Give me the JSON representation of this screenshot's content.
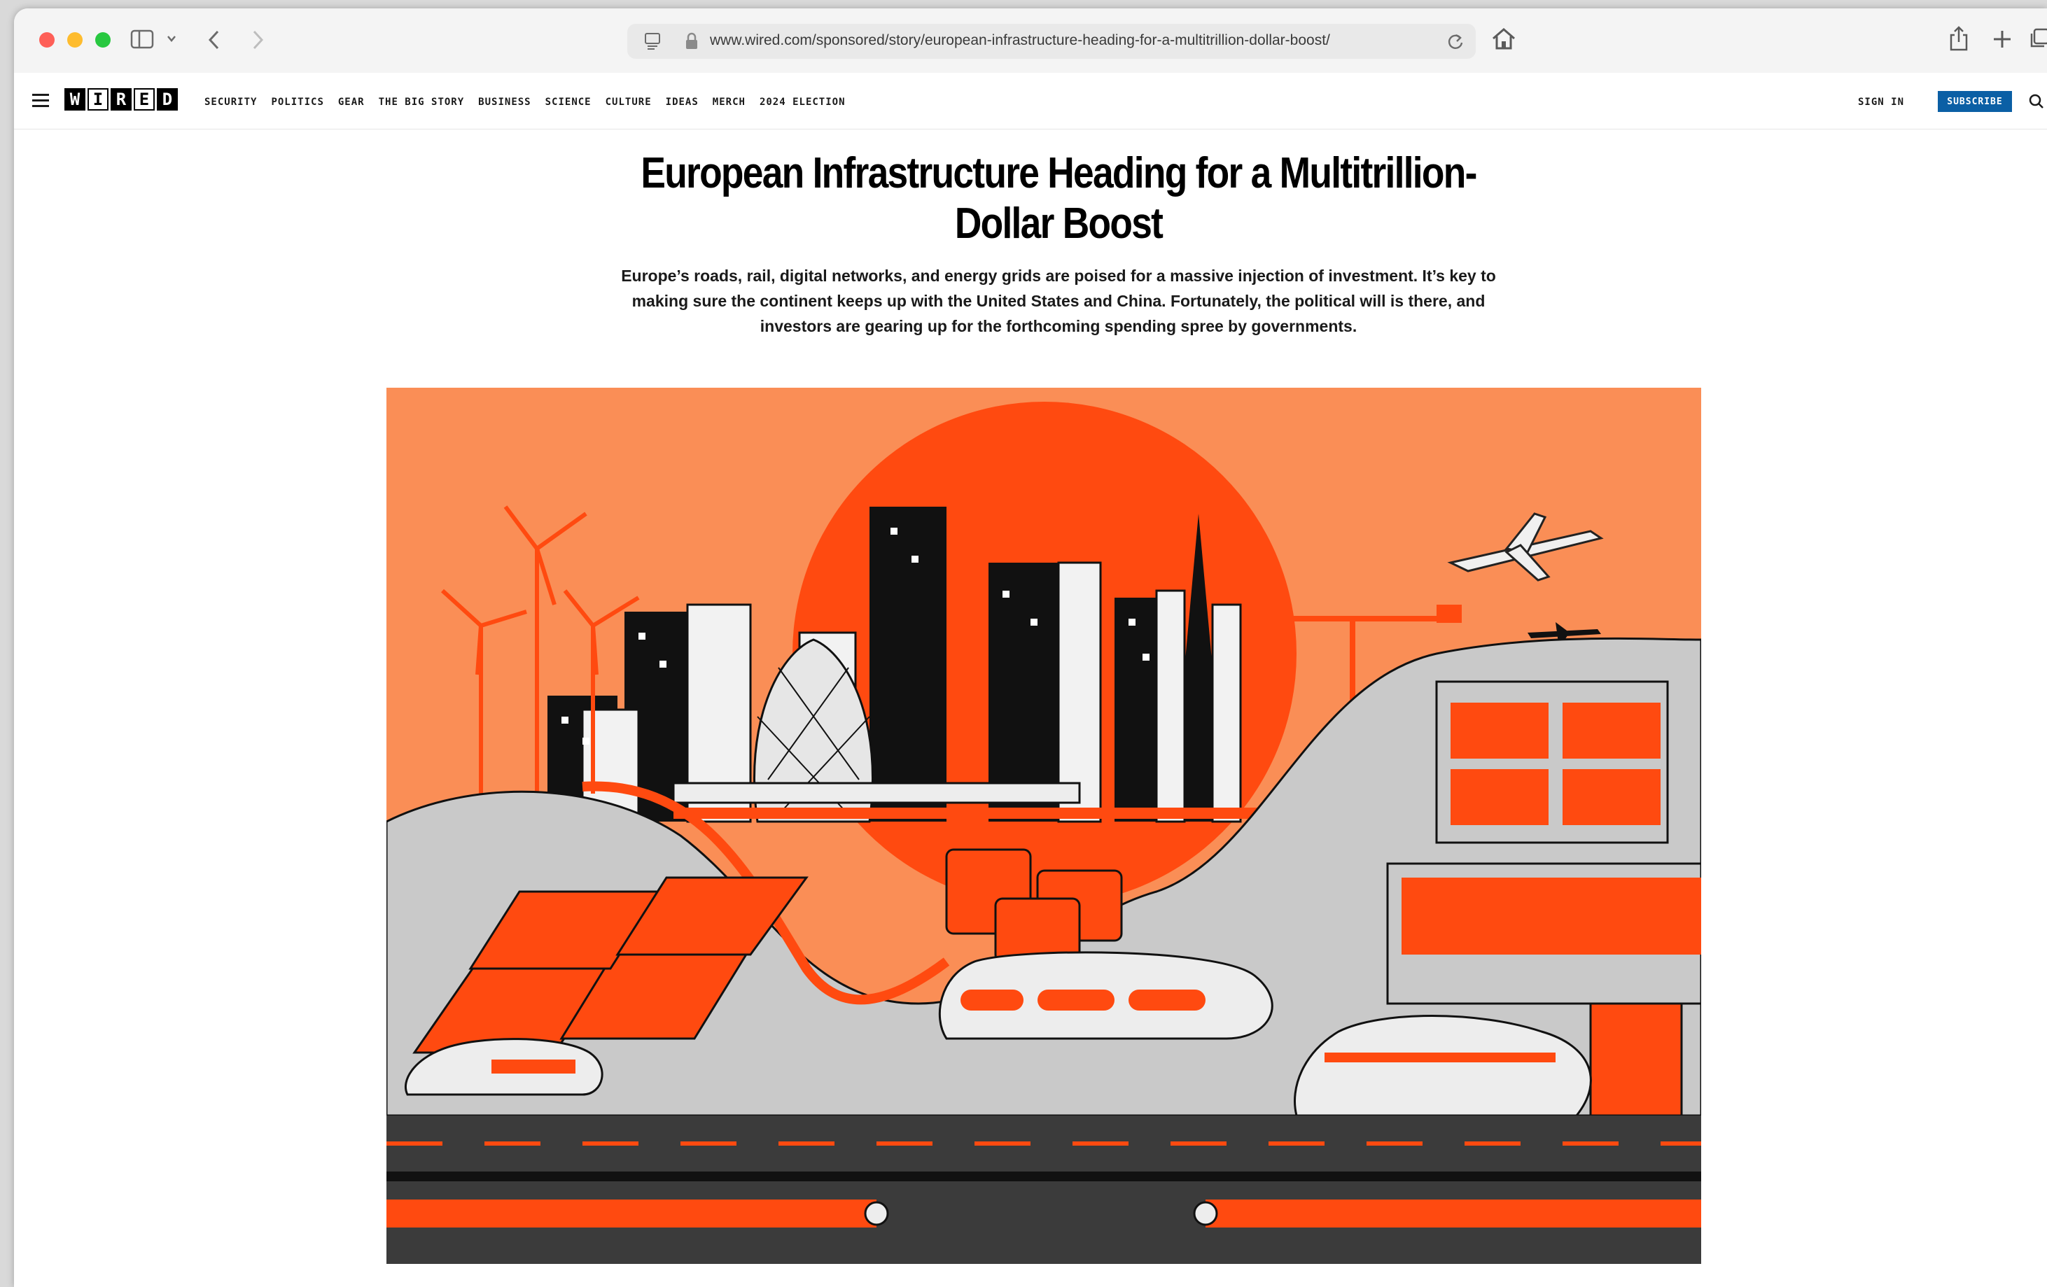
{
  "browser": {
    "url": "www.wired.com/sponsored/story/european-infrastructure-heading-for-a-multitrillion-dollar-boost/"
  },
  "site": {
    "logo_letters": [
      "W",
      "I",
      "R",
      "E",
      "D"
    ],
    "nav": [
      "SECURITY",
      "POLITICS",
      "GEAR",
      "THE BIG STORY",
      "BUSINESS",
      "SCIENCE",
      "CULTURE",
      "IDEAS",
      "MERCH",
      "2024 ELECTION"
    ],
    "sign_in": "SIGN IN",
    "subscribe": "SUBSCRIBE"
  },
  "article": {
    "headline": "European Infrastructure Heading for a Multitrillion-Dollar Boost",
    "dek": "Europe’s roads, rail, digital networks, and energy grids are poised for a massive injection of investment. It’s key to making sure the continent keeps up with the United States and China. Fortunately, the political will is there, and investors are gearing up for the forthcoming spending spree by governments."
  },
  "colors": {
    "accent_orange": "#ff4a10",
    "background_orange": "#fa8e56",
    "subscribe_blue": "#0b5fa5"
  }
}
